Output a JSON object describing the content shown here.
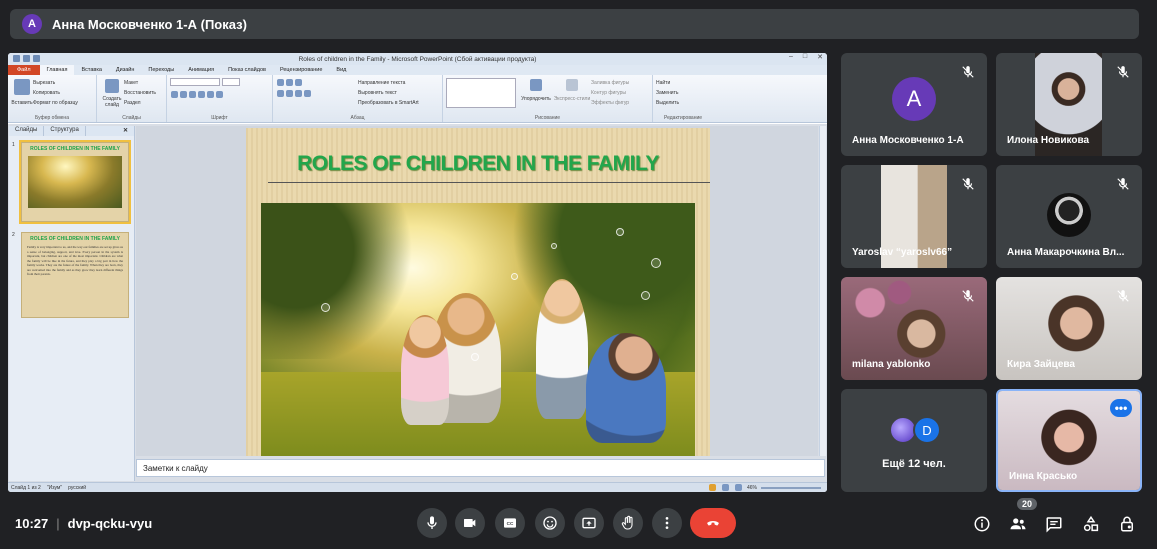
{
  "meeting": {
    "presenter_initial": "А",
    "title": "Анна Московченко 1-А (Показ)",
    "time": "10:27",
    "code": "dvp-qcku-vyu",
    "participant_count": "20"
  },
  "ppt": {
    "window_title": "Roles of children in the Family - Microsoft PowerPoint (Сбой активации продукта)",
    "tabs": [
      "Файл",
      "Главная",
      "Вставка",
      "Дизайн",
      "Переходы",
      "Анимация",
      "Показ слайдов",
      "Рецензирование",
      "Вид"
    ],
    "clipboard": {
      "paste": "Вставить",
      "cut": "Вырезать",
      "copy": "Копировать",
      "format": "Формат по образцу",
      "label": "Буфер обмена"
    },
    "slides_group": {
      "new": "Создать слайд",
      "layout": "Макет",
      "reset": "Восстановить",
      "section": "Раздел",
      "label": "Слайды"
    },
    "font_label": "Шрифт",
    "paragraph": {
      "direction": "Направление текста",
      "align": "Выровнять текст",
      "smartart": "Преобразовать в SmartArt",
      "label": "Абзац"
    },
    "drawing": {
      "arrange": "Упорядочить",
      "styles": "Экспресс-стили",
      "fill": "Заливка фигуры",
      "outline": "Контур фигуры",
      "effects": "Эффекты фигур",
      "label": "Рисование"
    },
    "editing": {
      "find": "Найти",
      "replace": "Заменить",
      "select": "Выделить",
      "label": "Редактирование"
    },
    "panel_tabs": {
      "slides": "Слайды",
      "outline": "Структура",
      "close": "✕"
    },
    "thumb1": {
      "num": "1",
      "title": "ROLES OF CHILDREN IN THE FAMILY"
    },
    "thumb2": {
      "num": "2",
      "title": "ROLES OF CHILDREN IN THE FAMILY",
      "text": "Family is very important to us, and the way our families are set up gives us a sense of belonging, support, and love. Every person in the system is important, but children are one of the most important. Children are what the family will be like in the future, and they play a big part in how the family works. They are the future of the family. When they are born, they are welcomed into the family and as they grow they learn different things from their parents."
    },
    "slide_title": "ROLES OF CHILDREN IN THE FAMILY",
    "notes_placeholder": "Заметки к слайду",
    "status": {
      "slide": "Слайд 1 из 2",
      "theme": "\"Изум\"",
      "lang": "русский",
      "zoom": "46%"
    }
  },
  "participants": [
    {
      "name": "Анна Московченко 1-А",
      "initial": "A",
      "avatar_color": "#673ab7"
    },
    {
      "name": "Илона Новикова"
    },
    {
      "name": "Yaroslav “yaroslv66”"
    },
    {
      "name": "Анна Макарочкина Вл..."
    },
    {
      "name": "milana yablonko"
    },
    {
      "name": "Кира Зайцева"
    },
    {
      "name": "Ещё 12 чел.",
      "stack_initial": "D"
    },
    {
      "name": "Инна Красько"
    }
  ],
  "colors": {
    "end_call": "#ea4335",
    "active_border": "#8ab4f8",
    "title_green": "#22a64c"
  }
}
